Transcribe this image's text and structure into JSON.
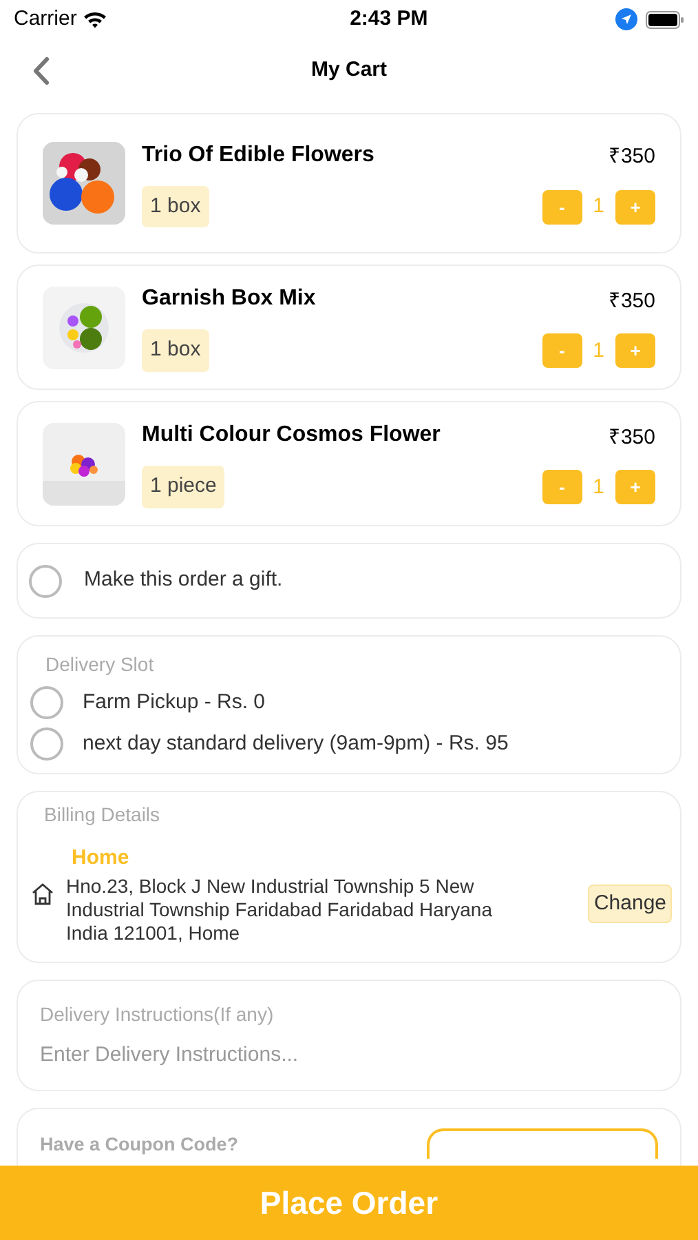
{
  "status_bar": {
    "carrier": "Carrier",
    "time": "2:43 PM"
  },
  "nav": {
    "title": "My Cart"
  },
  "cart_items": [
    {
      "name": "Trio Of Edible Flowers",
      "unit": "1 box",
      "price": "₹350",
      "quantity": "1",
      "minus": "-",
      "plus": "+"
    },
    {
      "name": "Garnish Box Mix",
      "unit": "1 box",
      "price": "₹350",
      "quantity": "1",
      "minus": "-",
      "plus": "+"
    },
    {
      "name": "Multi Colour Cosmos Flower",
      "unit": "1 piece",
      "price": "₹350",
      "quantity": "1",
      "minus": "-",
      "plus": "+"
    }
  ],
  "gift": {
    "label": "Make this order a gift.",
    "checked": false
  },
  "delivery_slot": {
    "heading": "Delivery Slot",
    "options": [
      {
        "label": "Farm Pickup - Rs. 0",
        "selected": false
      },
      {
        "label": "next day standard delivery (9am-9pm) - Rs. 95",
        "selected": false
      }
    ]
  },
  "billing": {
    "heading": "Billing Details",
    "address_label": "Home",
    "address": "Hno.23, Block J New Industrial Township 5 New Industrial Township Faridabad Faridabad Haryana India 121001, Home",
    "change_button": "Change"
  },
  "instructions": {
    "heading": "Delivery Instructions(If any)",
    "placeholder": "Enter Delivery Instructions..."
  },
  "coupon": {
    "heading": "Have a Coupon Code?"
  },
  "place_order": "Place Order"
}
